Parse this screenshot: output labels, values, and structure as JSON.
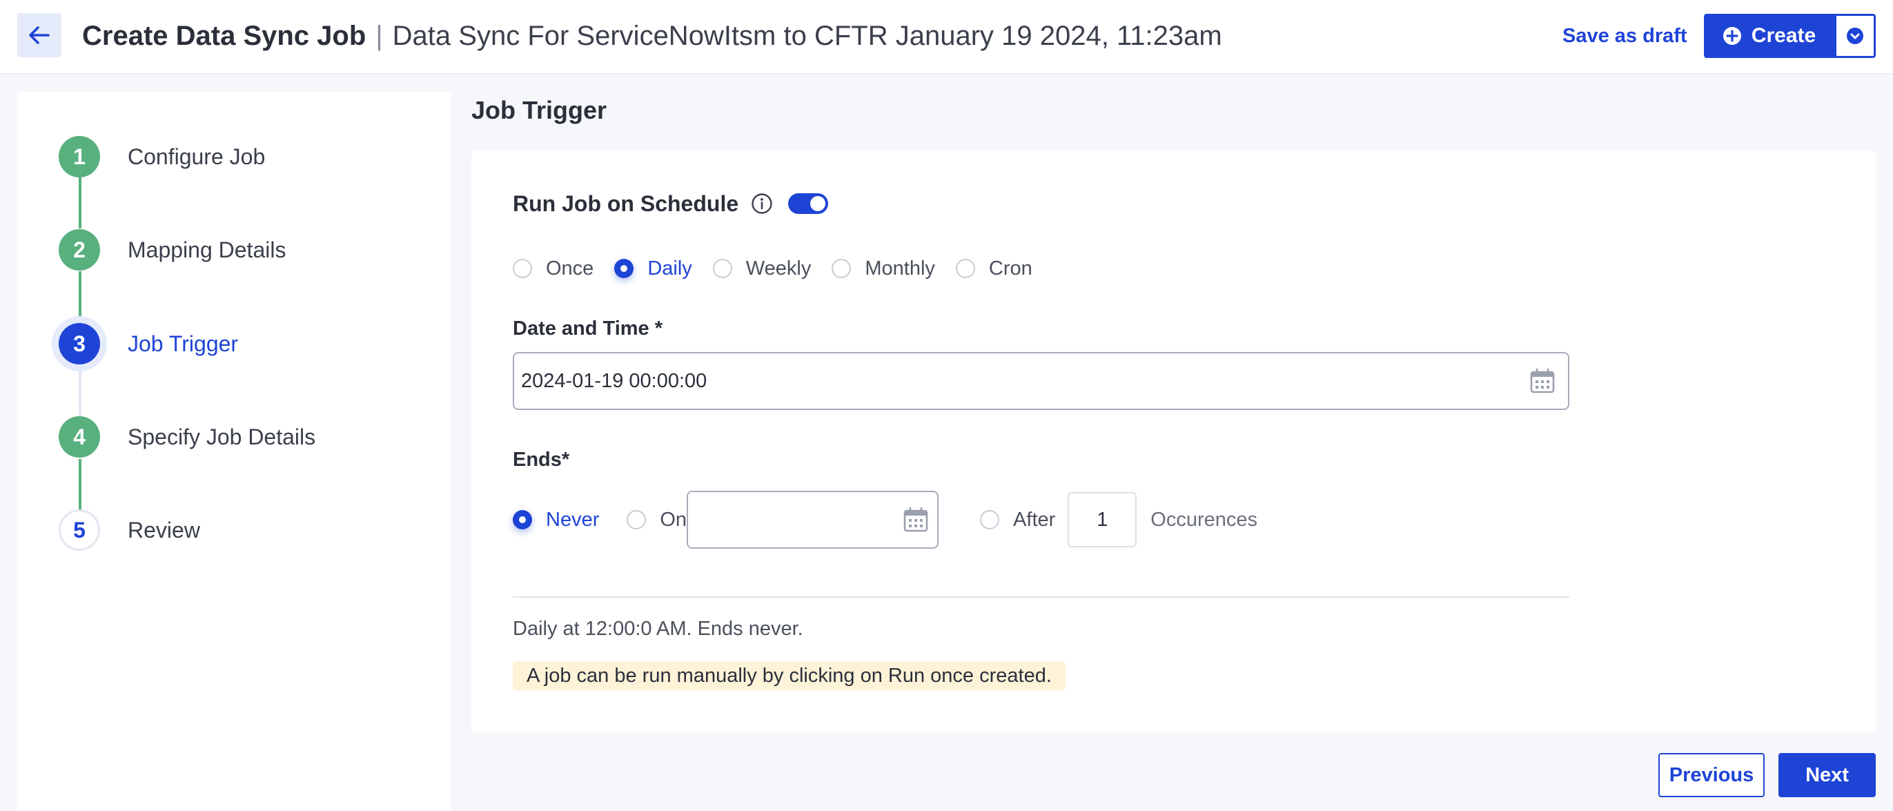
{
  "header": {
    "back_icon": "arrow-left-icon",
    "title": "Create Data Sync Job",
    "separator": "|",
    "subtitle": "Data Sync For ServiceNowItsm to CFTR January 19 2024, 11:23am",
    "save_draft_label": "Save as draft",
    "create_label": "Create",
    "create_icon": "plus-circle-icon",
    "create_dropdown_icon": "chevron-down-circle-icon"
  },
  "steps": [
    {
      "number": "1",
      "label": "Configure Job",
      "state": "done"
    },
    {
      "number": "2",
      "label": "Mapping Details",
      "state": "done"
    },
    {
      "number": "3",
      "label": "Job Trigger",
      "state": "active"
    },
    {
      "number": "4",
      "label": "Specify Job Details",
      "state": "done"
    },
    {
      "number": "5",
      "label": "Review",
      "state": "todo"
    }
  ],
  "main": {
    "section_title": "Job Trigger",
    "schedule": {
      "label": "Run Job on Schedule",
      "info_icon": "info-circle-icon",
      "toggle_on": true
    },
    "frequency": {
      "options": [
        "Once",
        "Daily",
        "Weekly",
        "Monthly",
        "Cron"
      ],
      "selected": "Daily"
    },
    "date_time": {
      "label": "Date and Time *",
      "value": "2024-01-19 00:00:00",
      "icon": "calendar-icon"
    },
    "ends": {
      "label": "Ends*",
      "never_label": "Never",
      "on_label": "On",
      "on_value": "",
      "after_label": "After",
      "after_count": "1",
      "occurrences_label": "Occurences",
      "selected": "Never"
    },
    "summary": "Daily at 12:00:0 AM. Ends never.",
    "note": "A job can be run manually by clicking on Run once created."
  },
  "footer": {
    "previous_label": "Previous",
    "next_label": "Next"
  },
  "colors": {
    "accent": "#1e44d6",
    "step_done": "#58b07e",
    "note_bg": "#fdf3d8"
  }
}
